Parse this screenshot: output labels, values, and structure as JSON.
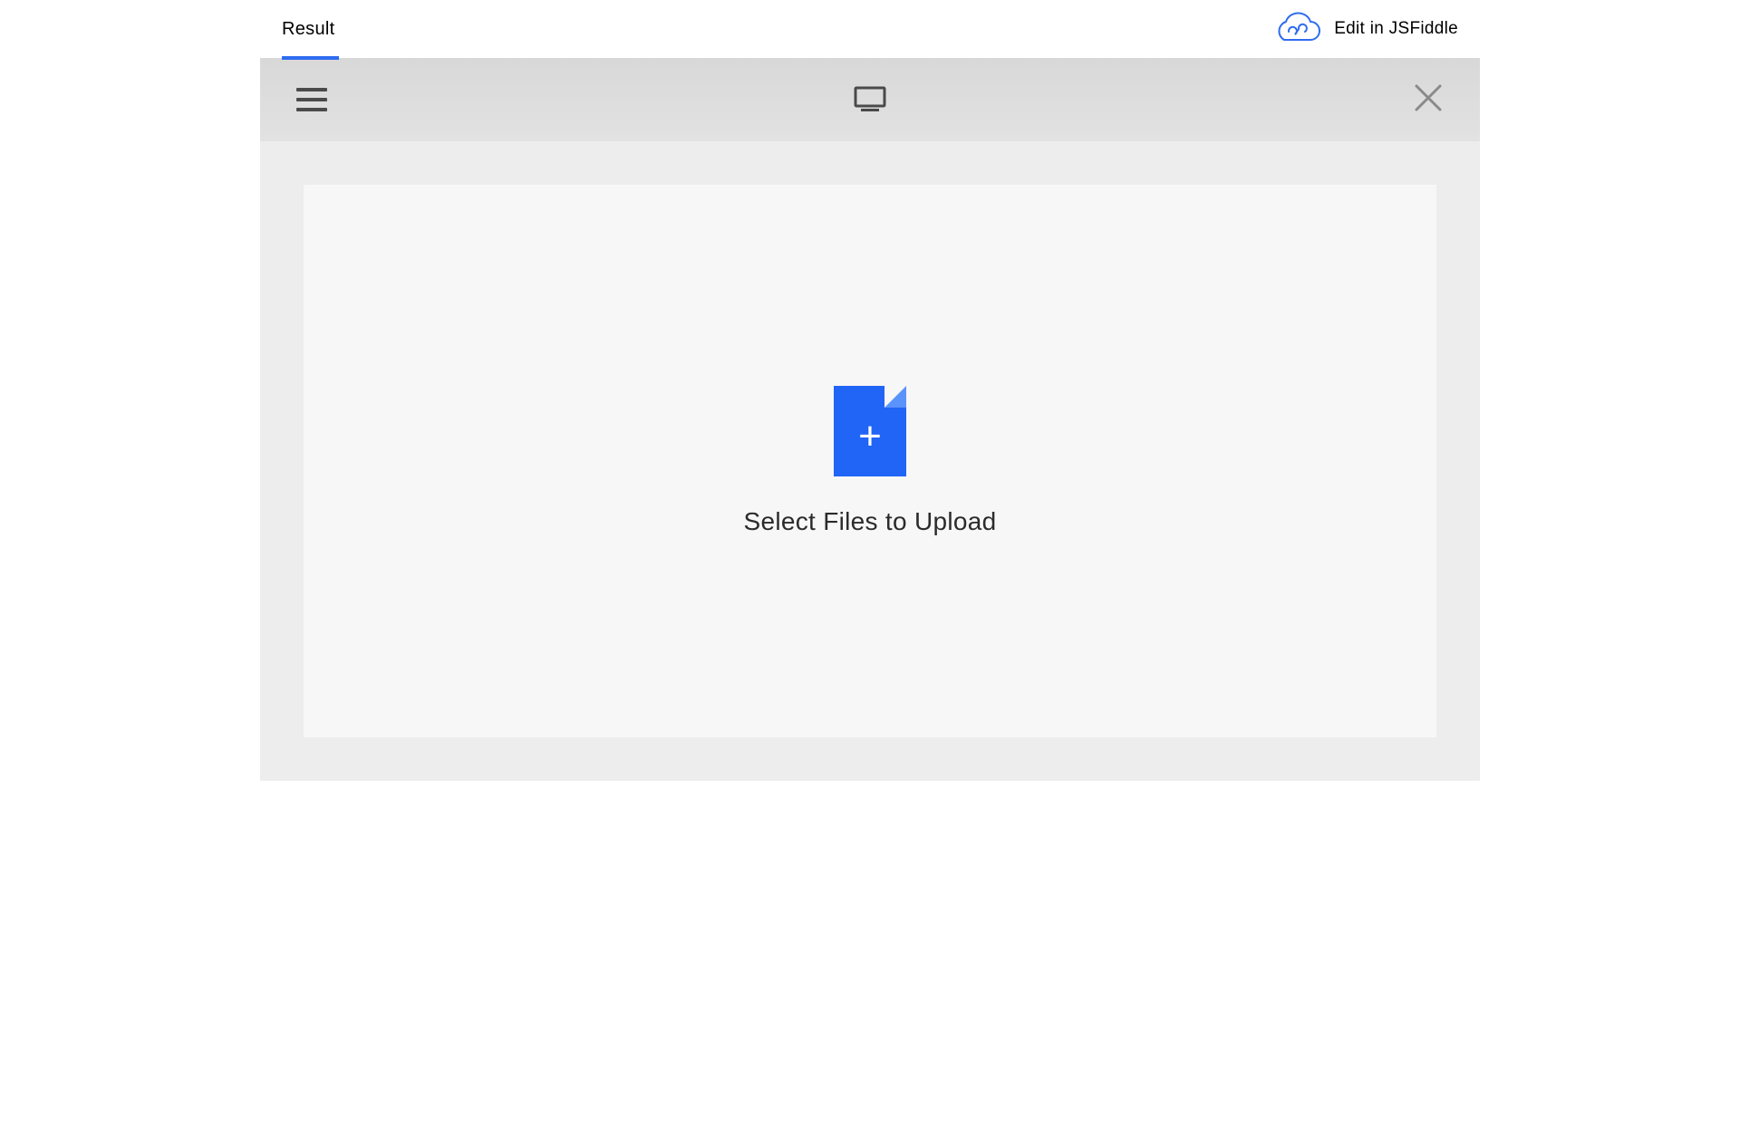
{
  "tabs": {
    "result": "Result"
  },
  "topRight": {
    "editLink": "Edit in JSFiddle"
  },
  "upload": {
    "prompt": "Select Files to Upload"
  },
  "colors": {
    "accent": "#2065f6",
    "tabUnderline": "#2f6cef"
  }
}
